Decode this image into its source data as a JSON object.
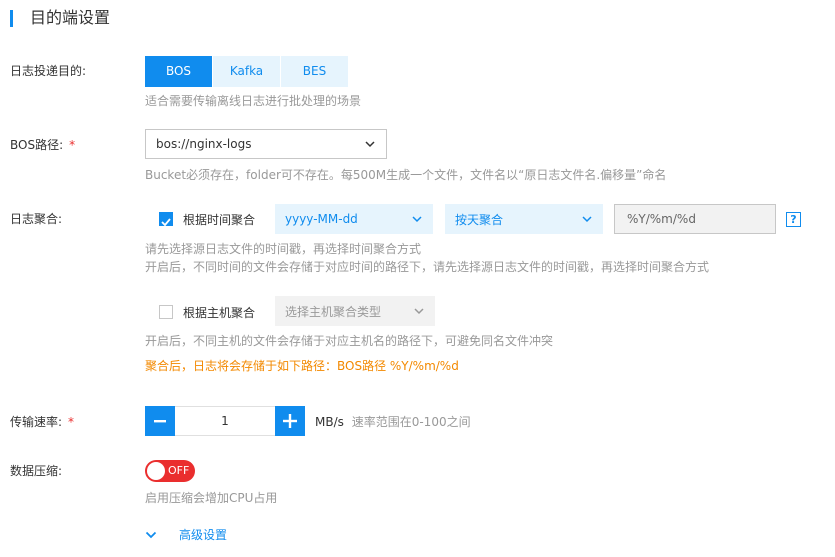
{
  "section_title": "目的端设置",
  "destination": {
    "label": "日志投递目的:",
    "options": [
      "BOS",
      "Kafka",
      "BES"
    ],
    "selected": "BOS",
    "hint": "适合需要传输离线日志进行批处理的场景"
  },
  "bos_path": {
    "label": "BOS路径:",
    "required_mark": "*",
    "value": "bos://nginx-logs",
    "hint": "Bucket必须存在，folder可不存在。每500M生成一个文件，文件名以“原日志文件名.偏移量”命名"
  },
  "aggregation": {
    "label": "日志聚合:",
    "time": {
      "checked": true,
      "label": "根据时间聚合",
      "format_value": "yyyy-MM-dd",
      "mode_value": "按天聚合",
      "pattern_value": "%Y/%m/%d",
      "help": "?",
      "hint1": "请先选择源日志文件的时间戳，再选择时间聚合方式",
      "hint2": "开启后，不同时间的文件会存储于对应时间的路径下，请先选择源日志文件的时间戳，再选择时间聚合方式"
    },
    "host": {
      "checked": false,
      "label": "根据主机聚合",
      "placeholder": "选择主机聚合类型",
      "hint": "开启后，不同主机的文件会存储于对应主机名的路径下，可避免同名文件冲突"
    },
    "result_note": "聚合后，日志将会存储于如下路径：BOS路径 %Y/%m/%d"
  },
  "rate": {
    "label": "传输速率:",
    "required_mark": "*",
    "value": "1",
    "unit": "MB/s",
    "hint": "速率范围在0-100之间"
  },
  "compression": {
    "label": "数据压缩:",
    "state": "OFF",
    "hint": "启用压缩会增加CPU占用"
  },
  "advanced": {
    "label": "高级设置"
  },
  "colors": {
    "accent": "#108cee",
    "required": "#ea2e2e",
    "warning": "#f38900",
    "toggle_off": "#ea2e2e"
  }
}
